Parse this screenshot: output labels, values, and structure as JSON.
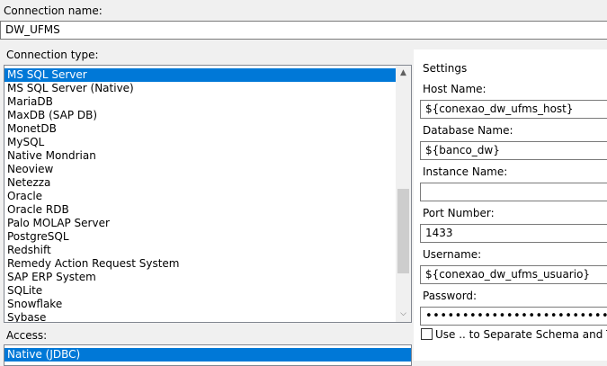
{
  "connection_name": {
    "label": "Connection name:",
    "value": "DW_UFMS"
  },
  "connection_type": {
    "label": "Connection type:",
    "items": [
      "MS SQL Server",
      "MS SQL Server (Native)",
      "MariaDB",
      "MaxDB (SAP DB)",
      "MonetDB",
      "MySQL",
      "Native Mondrian",
      "Neoview",
      "Netezza",
      "Oracle",
      "Oracle RDB",
      "Palo MOLAP Server",
      "PostgreSQL",
      "Redshift",
      "Remedy Action Request System",
      "SAP ERP System",
      "SQLite",
      "Snowflake",
      "Sybase"
    ],
    "selected_index": 0
  },
  "access": {
    "label": "Access:",
    "items": [
      "Native (JDBC)"
    ],
    "selected_index": 0
  },
  "settings": {
    "title": "Settings",
    "host_name": {
      "label": "Host Name:",
      "value": "${conexao_dw_ufms_host}"
    },
    "database_name": {
      "label": "Database Name:",
      "value": "${banco_dw}"
    },
    "instance_name": {
      "label": "Instance Name:",
      "value": ""
    },
    "port_number": {
      "label": "Port Number:",
      "value": "1433"
    },
    "username": {
      "label": "Username:",
      "value": "${conexao_dw_ufms_usuario}"
    },
    "password": {
      "label": "Password:",
      "value": "••••••••••••••••••••••••••"
    },
    "separate_schema": {
      "label": "Use .. to Separate Schema and Table",
      "checked": false
    }
  }
}
